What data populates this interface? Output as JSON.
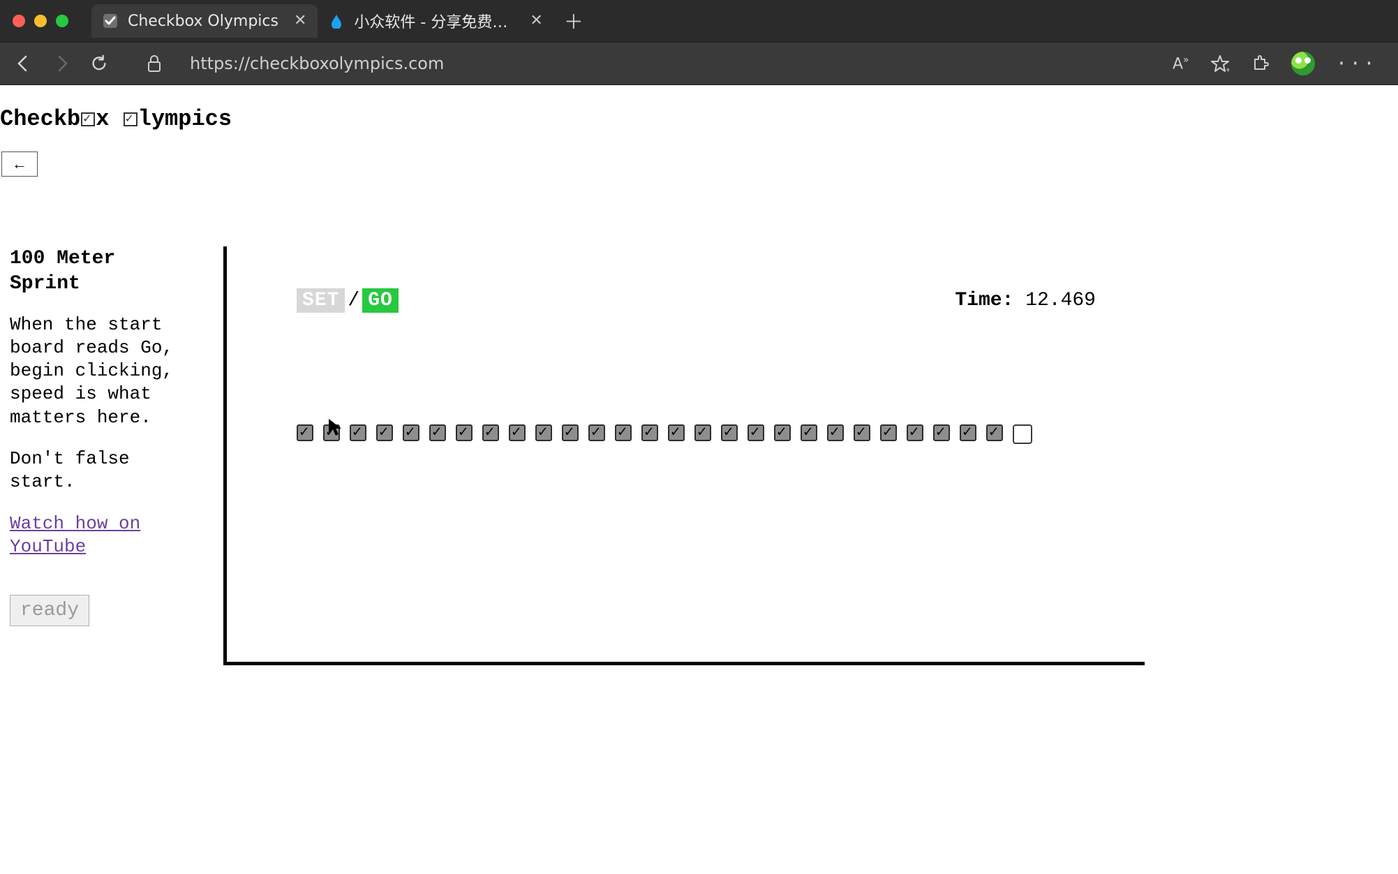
{
  "browser": {
    "tabs": [
      {
        "title": "Checkbox Olympics",
        "active": true
      },
      {
        "title": "小众软件 - 分享免费、小巧、实",
        "active": false
      }
    ],
    "url": "https://checkboxolympics.com"
  },
  "page": {
    "title_prefix": "Checkb",
    "title_mid": "x ",
    "title_suffix": "lympics",
    "back_button": "←"
  },
  "sidebar": {
    "heading": "100 Meter Sprint",
    "para1": "When the start board reads Go, begin clicking, speed is what matters here.",
    "para2": "Don't false start.",
    "link_text": "Watch how on YouTube",
    "ready_label": "ready"
  },
  "arena": {
    "status": {
      "set_label": "SET",
      "sep": "/",
      "go_label": "GO"
    },
    "timer": {
      "label": "Time:",
      "value": "12.469"
    },
    "checkboxes": {
      "checked_count": 27,
      "unchecked_count": 1
    }
  }
}
